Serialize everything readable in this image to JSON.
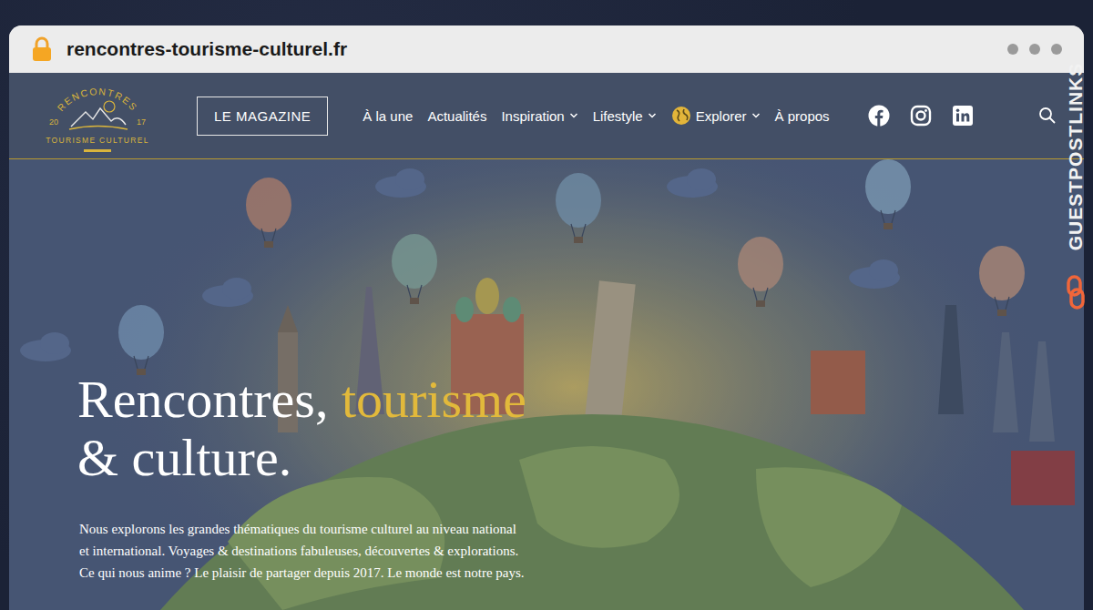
{
  "browser": {
    "url": "rencontres-tourisme-culturel.fr",
    "secure": true
  },
  "watermark": {
    "text": "GUESTPOSTLINKS"
  },
  "logo": {
    "top": "RENCONTRES",
    "year_left": "20",
    "year_right": "17",
    "bottom": "TOURISME CULTUREL"
  },
  "header": {
    "magazine_button": "LE MAGAZINE",
    "nav": [
      {
        "label": "À la une",
        "kind": "plain"
      },
      {
        "label": "Actualités",
        "kind": "plain"
      },
      {
        "label": "Inspiration",
        "kind": "menu"
      },
      {
        "label": "Lifestyle",
        "kind": "menu"
      },
      {
        "label": "Explorer",
        "kind": "explore"
      },
      {
        "label": "À propos",
        "kind": "plain"
      }
    ]
  },
  "hero": {
    "title_lines": [
      [
        {
          "text": "Rencontres,",
          "color": "#ffffff"
        },
        {
          "text": "tourisme",
          "color": "#e2b93b"
        }
      ],
      [
        {
          "text": "& culture.",
          "color": "#ffffff"
        }
      ]
    ],
    "paragraph_lines": [
      "Nous explorons les grandes thématiques du tourisme culturel au niveau national",
      "et international. Voyages & destinations fabuleuses, découvertes & explorations.",
      "Ce qui nous anime ? Le plaisir de partager depuis 2017. Le monde est notre pays."
    ]
  }
}
